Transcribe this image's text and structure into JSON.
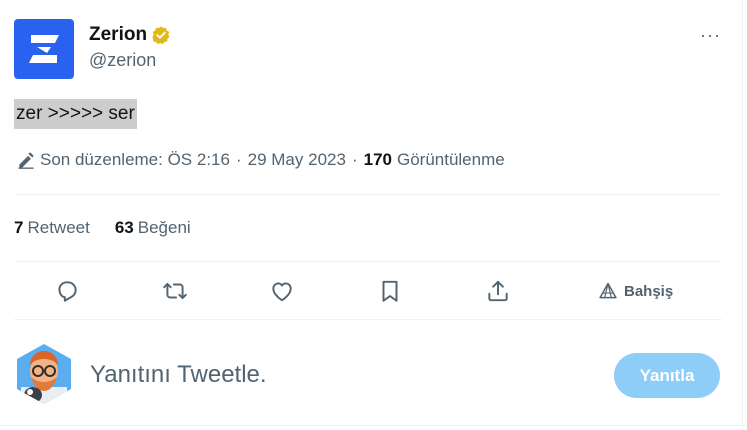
{
  "author": {
    "name": "Zerion",
    "handle": "@zerion",
    "verified_icon": "verified-badge-icon",
    "brand_color": "#2962ef",
    "badge_color": "#e2b719"
  },
  "more_menu": {
    "label": "···"
  },
  "tweet": {
    "text": "zer >>>>> ser",
    "edited_label": "Son düzenleme: ÖS 2:16",
    "separator": "·",
    "date": "29 May 2023",
    "views_count": "170",
    "views_label": "Görüntülenme"
  },
  "stats": [
    {
      "count": "7",
      "label": "Retweet"
    },
    {
      "count": "63",
      "label": "Beğeni"
    }
  ],
  "actions": {
    "reply_icon": "reply-icon",
    "retweet_icon": "retweet-icon",
    "like_icon": "heart-icon",
    "bookmark_icon": "bookmark-icon",
    "share_icon": "share-icon",
    "tip_label": "Bahşiş"
  },
  "reply": {
    "placeholder": "Yanıtını Tweetle.",
    "button_label": "Yanıtla",
    "button_color": "#8ecdf8"
  }
}
